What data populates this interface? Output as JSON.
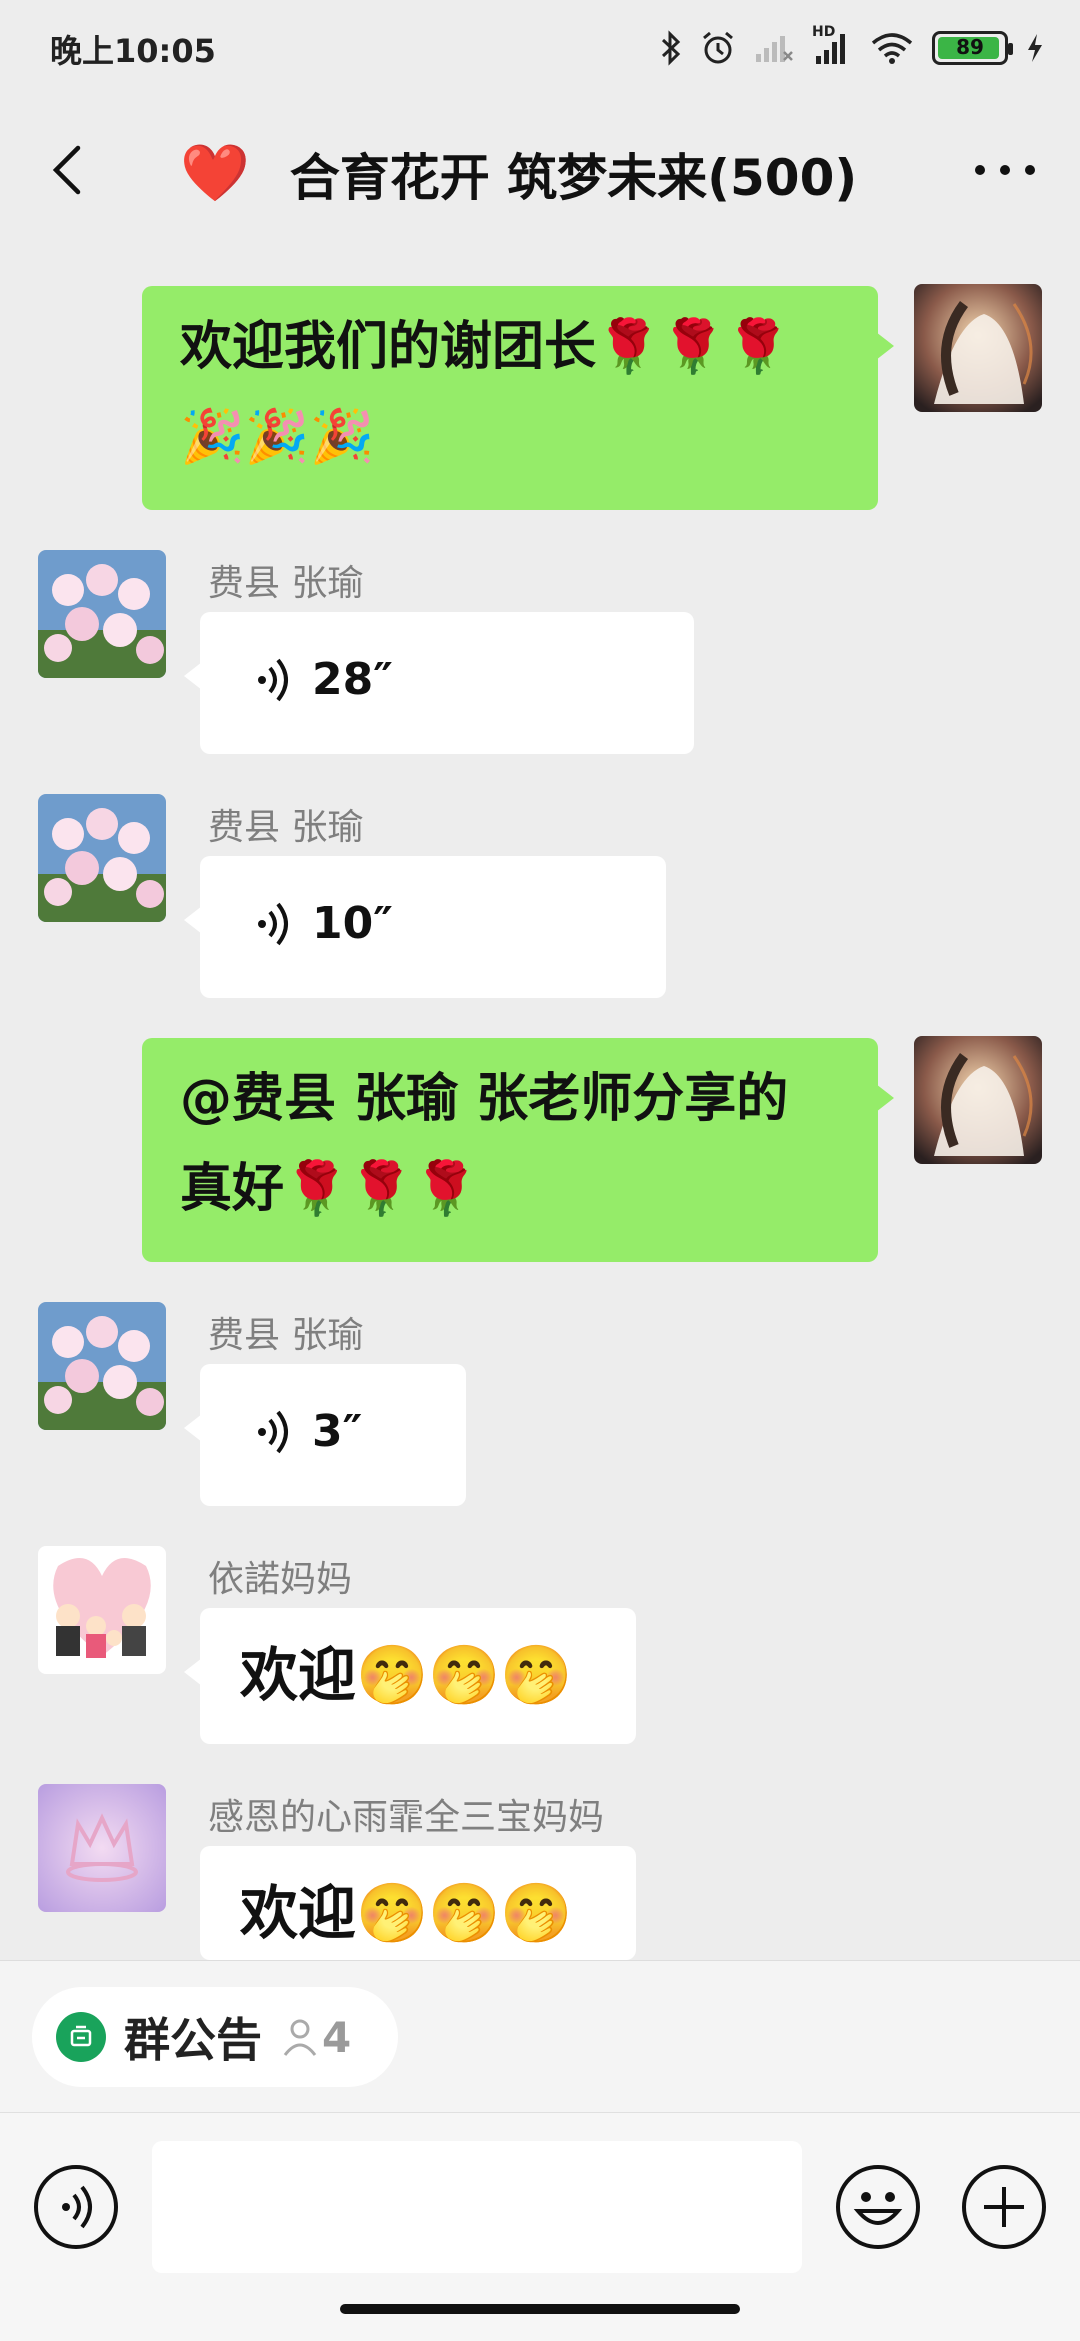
{
  "status_bar": {
    "time": "晚上10:05",
    "battery": "89",
    "battery_level": 0.89,
    "icons": [
      "bluetooth-icon",
      "alarm-icon",
      "signal-x-icon",
      "hd-signal-icon",
      "wifi-icon",
      "battery-icon",
      "charging-icon"
    ],
    "hd_label": "HD"
  },
  "nav": {
    "back_icon": "chevron-left-icon",
    "title_emoji": "❤️",
    "title": "合育花开 筑梦未来(500)",
    "more_icon": "more-dots-icon"
  },
  "messages": [
    {
      "type": "text",
      "self": true,
      "text": "欢迎我们的谢团长🌹🌹🌹🎉🎉🎉"
    },
    {
      "type": "voice",
      "sender": "费县 张瑜",
      "duration": "28″"
    },
    {
      "type": "voice",
      "sender": "费县 张瑜",
      "duration": "10″"
    },
    {
      "type": "text",
      "self": true,
      "text": "@费县 张瑜  张老师分享的真好🌹🌹🌹"
    },
    {
      "type": "voice",
      "sender": "费县 张瑜",
      "duration": "3″"
    },
    {
      "type": "text",
      "sender": "依諾妈妈",
      "text": "欢迎🤭🤭🤭"
    },
    {
      "type": "text",
      "sender": "感恩的心雨霏全三宝妈妈",
      "text": "欢迎🤭🤭🤭"
    }
  ],
  "notice": {
    "label": "群公告",
    "count": "4"
  },
  "colors": {
    "green_bubble": "#95ec69",
    "background": "#ededed",
    "notice_green": "#19a35b"
  }
}
